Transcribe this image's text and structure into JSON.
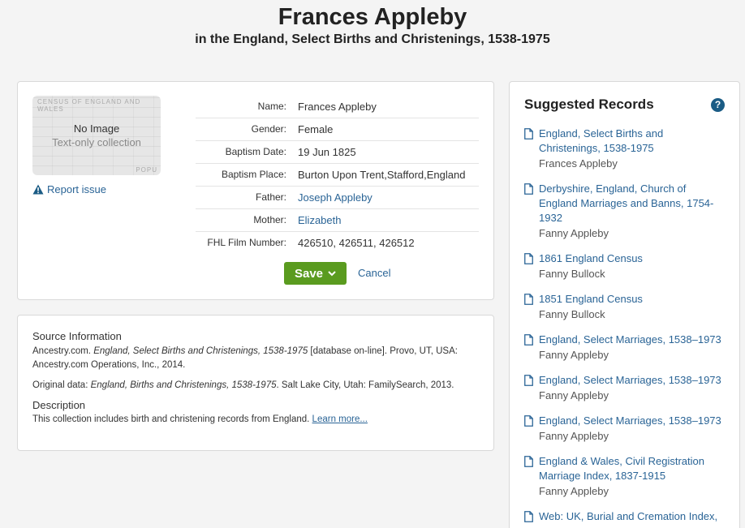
{
  "header": {
    "title": "Frances Appleby",
    "subtitle": "in the England, Select Births and Christenings, 1538-1975"
  },
  "record": {
    "thumbnail": {
      "label": "No Image",
      "sublabel": "Text-only collection",
      "bg_text_top": "CENSUS OF ENGLAND AND WALES",
      "bg_text_bottom": "POPU"
    },
    "report_issue": "Report issue",
    "fields": [
      {
        "label": "Name:",
        "value": "Frances Appleby",
        "link": false
      },
      {
        "label": "Gender:",
        "value": "Female",
        "link": false
      },
      {
        "label": "Baptism Date:",
        "value": "19 Jun 1825",
        "link": false
      },
      {
        "label": "Baptism Place:",
        "value": "Burton Upon Trent,Stafford,England",
        "link": false
      },
      {
        "label": "Father:",
        "value": "Joseph Appleby",
        "link": true
      },
      {
        "label": "Mother:",
        "value": "Elizabeth",
        "link": true
      },
      {
        "label": "FHL Film Number:",
        "value": "426510, 426511, 426512",
        "link": false
      }
    ],
    "save_label": "Save",
    "cancel_label": "Cancel"
  },
  "source": {
    "title": "Source Information",
    "citation_prefix": "Ancestry.com. ",
    "citation_italic": "England, Select Births and Christenings, 1538-1975",
    "citation_suffix": " [database on-line]. Provo, UT, USA: Ancestry.com Operations, Inc., 2014.",
    "original_prefix": "Original data: ",
    "original_italic": "England, Births and Christenings, 1538-1975",
    "original_suffix": ". Salt Lake City, Utah: FamilySearch, 2013.",
    "description_title": "Description",
    "description_text": "This collection includes birth and christening records from England. ",
    "learn_more": "Learn more..."
  },
  "suggested": {
    "title": "Suggested Records",
    "help": "?",
    "items": [
      {
        "title": "England, Select Births and Christenings, 1538-1975",
        "name": "Frances Appleby"
      },
      {
        "title": "Derbyshire, England, Church of England Marriages and Banns, 1754-1932",
        "name": "Fanny Appleby"
      },
      {
        "title": "1861 England Census",
        "name": "Fanny Bullock"
      },
      {
        "title": "1851 England Census",
        "name": "Fanny Bullock"
      },
      {
        "title": "England, Select Marriages, 1538–1973",
        "name": "Fanny Appleby"
      },
      {
        "title": "England, Select Marriages, 1538–1973",
        "name": "Fanny Appleby"
      },
      {
        "title": "England, Select Marriages, 1538–1973",
        "name": "Fanny Appleby"
      },
      {
        "title": "England & Wales, Civil Registration Marriage Index, 1837-1915",
        "name": "Fanny Appleby"
      },
      {
        "title": "Web: UK, Burial and Cremation Index,",
        "name": ""
      }
    ]
  },
  "colors": {
    "link": "#2a6496",
    "save_button": "#5a9b1f",
    "help_icon": "#1b5c85"
  }
}
